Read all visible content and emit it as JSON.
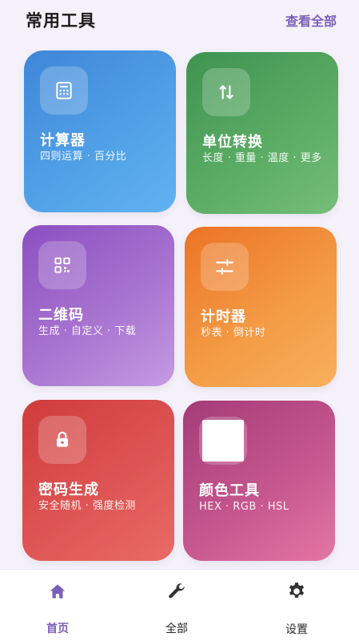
{
  "header": {
    "title": "常用工具",
    "view_all": "查看全部"
  },
  "tools": [
    {
      "name": "计算器",
      "desc": "四则运算 · 百分比",
      "icon": "calculator-icon",
      "colors": [
        "#3f86d8",
        "#61b1f2"
      ]
    },
    {
      "name": "单位转换",
      "desc": "长度 · 重量 · 温度 · 更多",
      "icon": "swap-vertical-icon",
      "colors": [
        "#3f9350",
        "#74be7a"
      ]
    },
    {
      "name": "二维码",
      "desc": "生成 · 自定义 · 下载",
      "icon": "qr-code-icon",
      "colors": [
        "#8b4fc0",
        "#c59ae3"
      ]
    },
    {
      "name": "计时器",
      "desc": "秒表 · 倒计时",
      "icon": "timer-icon",
      "colors": [
        "#ec7326",
        "#f8b05c"
      ]
    },
    {
      "name": "密码生成",
      "desc": "安全随机 · 强度检测",
      "icon": "lock-icon",
      "colors": [
        "#cf3c3c",
        "#e86b66"
      ]
    },
    {
      "name": "颜色工具",
      "desc": "HEX · RGB · HSL",
      "icon": "color-swatch-icon",
      "colors": [
        "#a43b78",
        "#e476a4"
      ]
    }
  ],
  "tabbar": {
    "items": [
      {
        "label": "首页",
        "icon": "home-icon",
        "active": true
      },
      {
        "label": "全部",
        "icon": "wrench-icon",
        "active": false
      },
      {
        "label": "设置",
        "icon": "gear-icon",
        "active": false
      }
    ],
    "active_color": "#7a5fb8",
    "inactive_color": "#2a2a2a"
  },
  "colors": {
    "background": "#f5f1fa",
    "accent": "#7a5fb8"
  }
}
